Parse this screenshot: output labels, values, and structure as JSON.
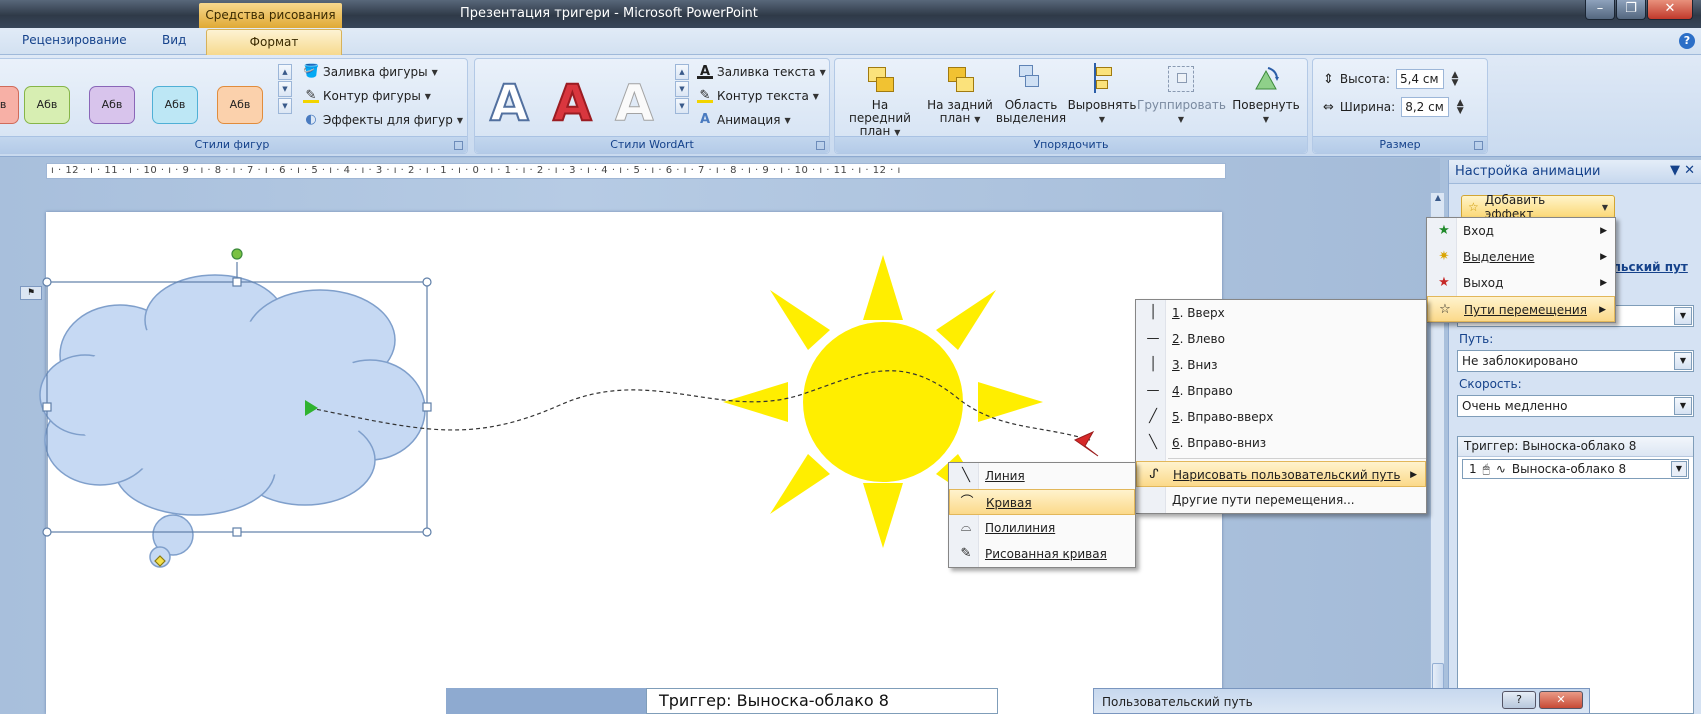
{
  "window": {
    "title": "Презентация тригери - Microsoft PowerPoint",
    "context_tab": "Средства рисования",
    "min_label": "–",
    "max_label": "❐",
    "close_label": "✕"
  },
  "tabs": {
    "review": "Рецензирование",
    "view": "Вид",
    "format": "Формат",
    "help": "?"
  },
  "ribbon": {
    "shape_styles": {
      "label": "Стили фигур",
      "swatch_text": "Абв",
      "fill": "Заливка фигуры",
      "outline": "Контур фигуры",
      "effects": "Эффекты для фигур"
    },
    "wordart": {
      "label": "Стили WordArt",
      "glyph": "A",
      "text_fill": "Заливка текста",
      "text_outline": "Контур текста",
      "animation": "Анимация"
    },
    "arrange": {
      "label": "Упорядочить",
      "bring_front_1": "На передний",
      "bring_front_2": "план",
      "send_back_1": "На задний",
      "send_back_2": "план",
      "selection_1": "Область",
      "selection_2": "выделения",
      "align": "Выровнять",
      "group": "Группировать",
      "rotate": "Повернуть"
    },
    "size": {
      "label": "Размер",
      "height_label": "Высота:",
      "height_value": "5,4 см",
      "width_label": "Ширина:",
      "width_value": "8,2 см"
    }
  },
  "ruler": {
    "text": "ı · 12 · ı · 11 · ı · 10 · ı · 9 · ı · 8 · ı · 7 · ı · 6 · ı · 5 · ı · 4 · ı · 3 · ı · 2 · ı · 1 · ı · 0 · ı · 1 · ı · 2 · ı · 3 · ı · 4 · ı · 5 · ı · 6 · ı · 7 · ı · 8 · ı · 9 · ı · 10 · ı · 11 · ı · 12 · ı"
  },
  "task_pane": {
    "title": "Настройка анимации",
    "add_effect": "Добавить эффект",
    "custom_path_link": "ельский пут",
    "path_label": "Путь:",
    "path_value": "Не заблокировано",
    "speed_label": "Скорость:",
    "speed_value": "Очень медленно",
    "trigger_header": "Триггер: Выноска-облако 8",
    "list_item_number": "1",
    "list_item_label": "Выноска-облако 8"
  },
  "effect_menu": {
    "items": [
      {
        "label": "Вход",
        "accel": "х"
      },
      {
        "label": "Выделение",
        "accel": "В"
      },
      {
        "label": "Выход",
        "accel": "ы"
      },
      {
        "label": "Пути перемещения",
        "accel": "П"
      }
    ]
  },
  "paths_menu": {
    "items": [
      {
        "num": "1",
        "label": ". Вверх"
      },
      {
        "num": "2",
        "label": ". Влево"
      },
      {
        "num": "3",
        "label": ". Вниз"
      },
      {
        "num": "4",
        "label": ". Вправо"
      },
      {
        "num": "5",
        "label": ". Вправо-вверх"
      },
      {
        "num": "6",
        "label": ". Вправо-вниз"
      }
    ],
    "draw_custom": "Нарисовать пользовательский путь",
    "other": "Другие пути перемещения..."
  },
  "draw_menu": {
    "items": [
      {
        "label": "Линия"
      },
      {
        "label": "Кривая"
      },
      {
        "label": "Полилиния"
      },
      {
        "label": "Рисованная кривая"
      }
    ]
  },
  "bottom": {
    "trigger_text": "Триггер: Выноска-облако 8",
    "dialog_title": "Пользовательский путь",
    "dialog_help": "?",
    "dialog_close": "✕"
  },
  "colors": {
    "sun": "#ffee00",
    "cloud": "#c6d9f3",
    "accent_tab": "#f6d88b",
    "highlight": "#fbd98a"
  }
}
